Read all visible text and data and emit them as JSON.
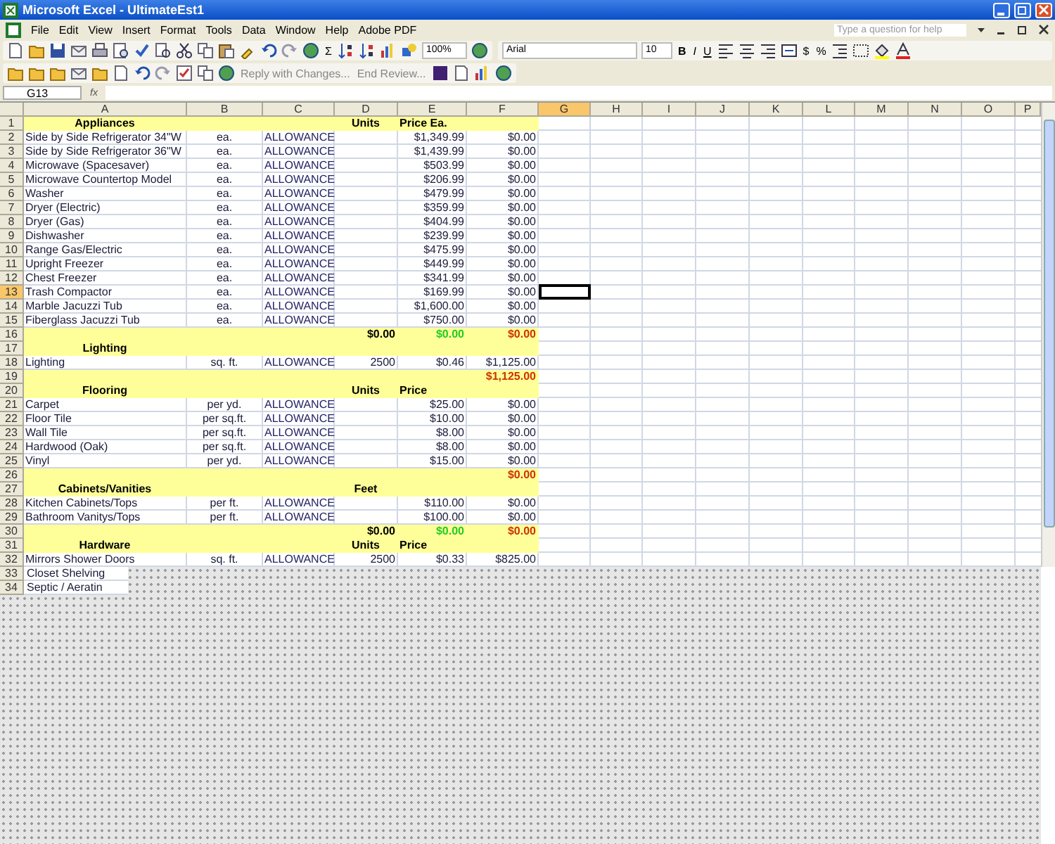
{
  "window": {
    "title": "Microsoft Excel - UltimateEst1"
  },
  "menu": [
    "File",
    "Edit",
    "View",
    "Insert",
    "Format",
    "Tools",
    "Data",
    "Window",
    "Help",
    "Adobe PDF"
  ],
  "help_search": {
    "placeholder": "Type a question for help"
  },
  "standard_toolbar": {
    "sum": "Σ",
    "zoom": "100%"
  },
  "formatting_toolbar": {
    "font": "Arial",
    "size": "10",
    "bold": "B",
    "italic": "I",
    "underline": "U",
    "currency": "$",
    "percent": "%"
  },
  "reviewing_toolbar": {
    "reply": "Reply with Changes...",
    "end_review": "End Review..."
  },
  "formula_bar": {
    "name_box": "G13",
    "fx": "fx"
  },
  "columns": [
    {
      "label": "A",
      "selected": false
    },
    {
      "label": "B",
      "selected": false
    },
    {
      "label": "C",
      "selected": false
    },
    {
      "label": "D",
      "selected": false
    },
    {
      "label": "E",
      "selected": false
    },
    {
      "label": "F",
      "selected": false
    },
    {
      "label": "G",
      "selected": true
    },
    {
      "label": "H",
      "selected": false
    },
    {
      "label": "I",
      "selected": false
    },
    {
      "label": "J",
      "selected": false
    },
    {
      "label": "K",
      "selected": false
    },
    {
      "label": "L",
      "selected": false
    },
    {
      "label": "M",
      "selected": false
    },
    {
      "label": "N",
      "selected": false
    },
    {
      "label": "O",
      "selected": false
    },
    {
      "label": "P",
      "selected": false
    }
  ],
  "rows": [
    {
      "num": "1",
      "kind": "header",
      "selected": false,
      "cells": {
        "a": "Appliances",
        "d": "Units",
        "e": "Price Ea."
      }
    },
    {
      "num": "2",
      "kind": "item",
      "selected": false,
      "cells": {
        "a": "Side by Side Refrigerator 34\"W",
        "b": "ea.",
        "c": "ALLOWANCE",
        "e": "$1,349.99",
        "f": "$0.00"
      }
    },
    {
      "num": "3",
      "kind": "item",
      "selected": false,
      "cells": {
        "a": "Side by Side Refrigerator 36\"W",
        "b": "ea.",
        "c": "ALLOWANCE",
        "e": "$1,439.99",
        "f": "$0.00"
      }
    },
    {
      "num": "4",
      "kind": "item",
      "selected": false,
      "cells": {
        "a": "Microwave (Spacesaver)",
        "b": "ea.",
        "c": "ALLOWANCE",
        "e": "$503.99",
        "f": "$0.00"
      }
    },
    {
      "num": "5",
      "kind": "item",
      "selected": false,
      "cells": {
        "a": "Microwave Countertop Model",
        "b": "ea.",
        "c": "ALLOWANCE",
        "e": "$206.99",
        "f": "$0.00"
      }
    },
    {
      "num": "6",
      "kind": "item",
      "selected": false,
      "cells": {
        "a": "Washer",
        "b": "ea.",
        "c": "ALLOWANCE",
        "e": "$479.99",
        "f": "$0.00"
      }
    },
    {
      "num": "7",
      "kind": "item",
      "selected": false,
      "cells": {
        "a": "Dryer (Electric)",
        "b": "ea.",
        "c": "ALLOWANCE",
        "e": "$359.99",
        "f": "$0.00"
      }
    },
    {
      "num": "8",
      "kind": "item",
      "selected": false,
      "cells": {
        "a": "Dryer (Gas)",
        "b": "ea.",
        "c": "ALLOWANCE",
        "e": "$404.99",
        "f": "$0.00"
      }
    },
    {
      "num": "9",
      "kind": "item",
      "selected": false,
      "cells": {
        "a": "Dishwasher",
        "b": "ea.",
        "c": "ALLOWANCE",
        "e": "$239.99",
        "f": "$0.00"
      }
    },
    {
      "num": "10",
      "kind": "item",
      "selected": false,
      "cells": {
        "a": "Range Gas/Electric",
        "b": "ea.",
        "c": "ALLOWANCE",
        "e": "$475.99",
        "f": "$0.00"
      }
    },
    {
      "num": "11",
      "kind": "item",
      "selected": false,
      "cells": {
        "a": "Upright Freezer",
        "b": "ea.",
        "c": "ALLOWANCE",
        "e": "$449.99",
        "f": "$0.00"
      }
    },
    {
      "num": "12",
      "kind": "item",
      "selected": false,
      "cells": {
        "a": "Chest Freezer",
        "b": "ea.",
        "c": "ALLOWANCE",
        "e": "$341.99",
        "f": "$0.00"
      }
    },
    {
      "num": "13",
      "kind": "item",
      "selected": true,
      "cells": {
        "a": "Trash Compactor",
        "b": "ea.",
        "c": "ALLOWANCE",
        "e": "$169.99",
        "f": "$0.00"
      }
    },
    {
      "num": "14",
      "kind": "item",
      "selected": false,
      "cells": {
        "a": "Marble Jacuzzi Tub",
        "b": "ea.",
        "c": "ALLOWANCE",
        "e": "$1,600.00",
        "f": "$0.00"
      }
    },
    {
      "num": "15",
      "kind": "item",
      "selected": false,
      "cells": {
        "a": "Fiberglass Jacuzzi Tub",
        "b": "ea.",
        "c": "ALLOWANCE",
        "e": "$750.00",
        "f": "$0.00"
      }
    },
    {
      "num": "16",
      "kind": "subtotal",
      "selected": false,
      "cells": {
        "d": "$0.00",
        "e": "$0.00",
        "f": "$0.00"
      }
    },
    {
      "num": "17",
      "kind": "header",
      "selected": false,
      "cells": {
        "a": "Lighting"
      }
    },
    {
      "num": "18",
      "kind": "item",
      "selected": false,
      "cells": {
        "a": "Lighting",
        "b": "sq. ft.",
        "c": "ALLOWANCE",
        "d": "2500",
        "e": "$0.46",
        "f": "$1,125.00"
      }
    },
    {
      "num": "19",
      "kind": "subtotal",
      "selected": false,
      "cells": {
        "f": "$1,125.00"
      }
    },
    {
      "num": "20",
      "kind": "header",
      "selected": false,
      "cells": {
        "a": "Flooring",
        "d": "Units",
        "e": "Price"
      }
    },
    {
      "num": "21",
      "kind": "item",
      "selected": false,
      "cells": {
        "a": "Carpet",
        "b": "per yd.",
        "c": "ALLOWANCE",
        "e": "$25.00",
        "f": "$0.00"
      }
    },
    {
      "num": "22",
      "kind": "item",
      "selected": false,
      "cells": {
        "a": "Floor Tile",
        "b": "per sq.ft.",
        "c": "ALLOWANCE",
        "e": "$10.00",
        "f": "$0.00"
      }
    },
    {
      "num": "23",
      "kind": "item",
      "selected": false,
      "cells": {
        "a": "Wall Tile",
        "b": "per sq.ft.",
        "c": "ALLOWANCE",
        "e": "$8.00",
        "f": "$0.00"
      }
    },
    {
      "num": "24",
      "kind": "item",
      "selected": false,
      "cells": {
        "a": "Hardwood (Oak)",
        "b": "per sq.ft.",
        "c": "ALLOWANCE",
        "e": "$8.00",
        "f": "$0.00"
      }
    },
    {
      "num": "25",
      "kind": "item",
      "selected": false,
      "cells": {
        "a": "Vinyl",
        "b": "per yd.",
        "c": "ALLOWANCE",
        "e": "$15.00",
        "f": "$0.00"
      }
    },
    {
      "num": "26",
      "kind": "subtotal",
      "selected": false,
      "cells": {
        "f": "$0.00"
      }
    },
    {
      "num": "27",
      "kind": "header",
      "selected": false,
      "cells": {
        "a": "Cabinets/Vanities",
        "d": "Feet"
      }
    },
    {
      "num": "28",
      "kind": "item",
      "selected": false,
      "cells": {
        "a": "Kitchen Cabinets/Tops",
        "b": "per ft.",
        "c": "ALLOWANCE",
        "e": "$110.00",
        "f": "$0.00"
      }
    },
    {
      "num": "29",
      "kind": "item",
      "selected": false,
      "cells": {
        "a": "Bathroom Vanitys/Tops",
        "b": "per ft.",
        "c": "ALLOWANCE",
        "e": "$100.00",
        "f": "$0.00"
      }
    },
    {
      "num": "30",
      "kind": "subtotal",
      "selected": false,
      "cells": {
        "d": "$0.00",
        "e": "$0.00",
        "f": "$0.00"
      }
    },
    {
      "num": "31",
      "kind": "header",
      "selected": false,
      "cells": {
        "a": "Hardware",
        "d": "Units",
        "e": "Price"
      }
    },
    {
      "num": "32",
      "kind": "item",
      "selected": false,
      "cells": {
        "a": "Mirrors Shower Doors",
        "b": "sq. ft.",
        "c": "ALLOWANCE",
        "d": "2500",
        "e": "$0.33",
        "f": "$825.00"
      }
    },
    {
      "num": "33",
      "kind": "cut",
      "selected": false,
      "cells": {
        "a": "Closet Shelving"
      }
    },
    {
      "num": "34",
      "kind": "cut",
      "selected": false,
      "cells": {
        "a": "Septic / Aeratin"
      }
    }
  ]
}
